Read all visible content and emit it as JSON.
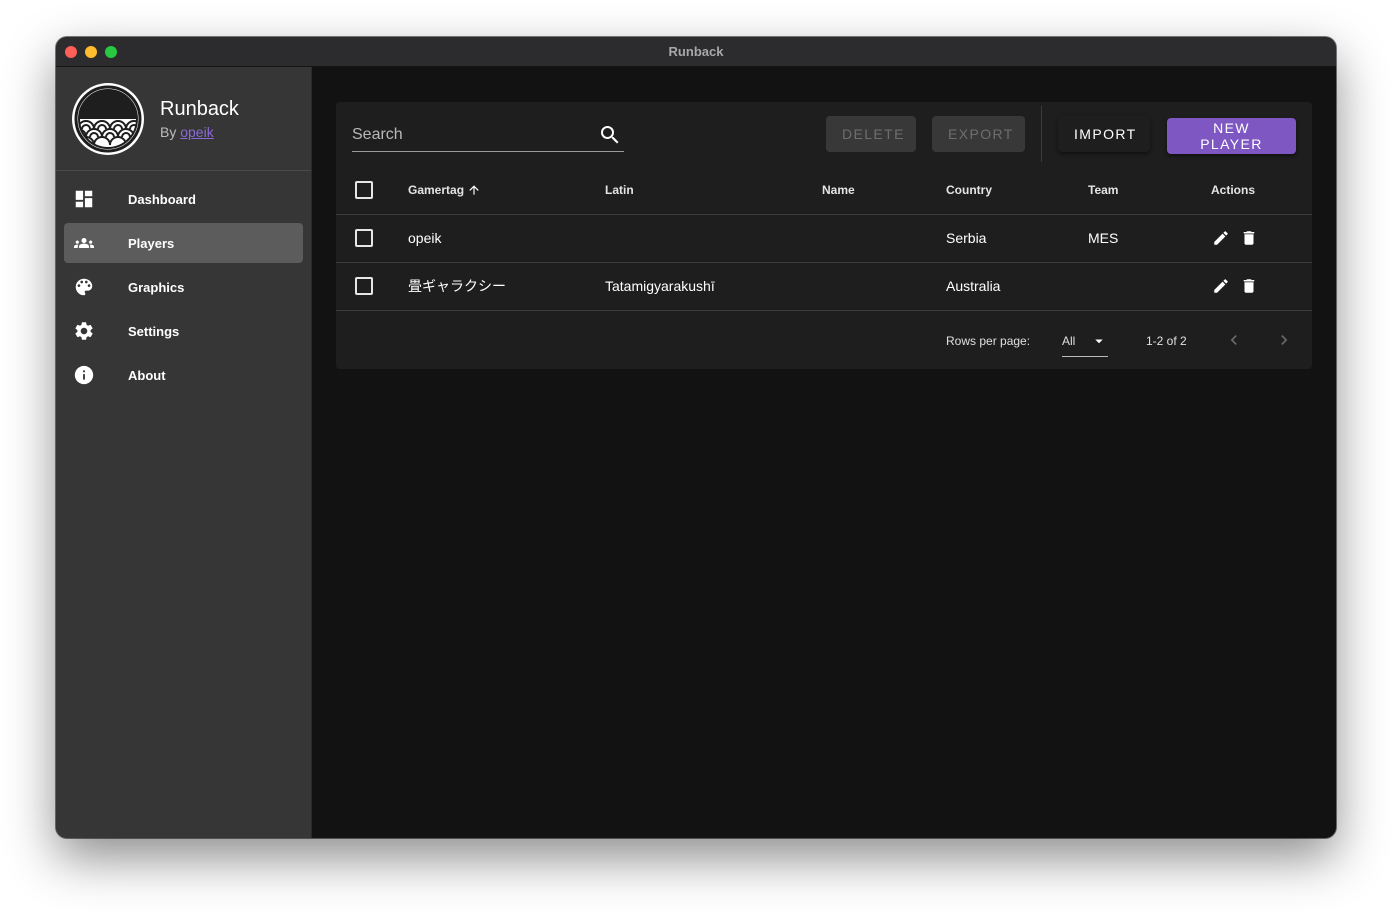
{
  "window": {
    "title": "Runback"
  },
  "brand": {
    "name": "Runback",
    "by_prefix": "By",
    "author": "opeik"
  },
  "sidebar": {
    "items": [
      {
        "label": "Dashboard",
        "icon": "dashboard-icon",
        "active": false
      },
      {
        "label": "Players",
        "icon": "people-icon",
        "active": true
      },
      {
        "label": "Graphics",
        "icon": "palette-icon",
        "active": false
      },
      {
        "label": "Settings",
        "icon": "gear-icon",
        "active": false
      },
      {
        "label": "About",
        "icon": "info-icon",
        "active": false
      }
    ]
  },
  "toolbar": {
    "search_placeholder": "Search",
    "delete_label": "DELETE",
    "export_label": "EXPORT",
    "import_label": "IMPORT",
    "new_player_label": "NEW PLAYER"
  },
  "table": {
    "headers": {
      "gamertag": "Gamertag",
      "latin": "Latin",
      "name": "Name",
      "country": "Country",
      "team": "Team",
      "actions": "Actions"
    },
    "sort": {
      "column": "gamertag",
      "direction": "ascending"
    },
    "rows": [
      {
        "gamertag": "opeik",
        "latin": "",
        "name": "",
        "country": "Serbia",
        "team": "MES"
      },
      {
        "gamertag": "畳ギャラクシー",
        "latin": "Tatamigyarakushī",
        "name": "",
        "country": "Australia",
        "team": ""
      }
    ]
  },
  "pagination": {
    "rows_per_page_label": "Rows per page:",
    "rows_per_page_value": "All",
    "range_text": "1-2 of 2"
  },
  "colors": {
    "accent": "#7e57c2",
    "background": "#121212",
    "sidebar": "#363636",
    "card": "#1e1e1e"
  }
}
